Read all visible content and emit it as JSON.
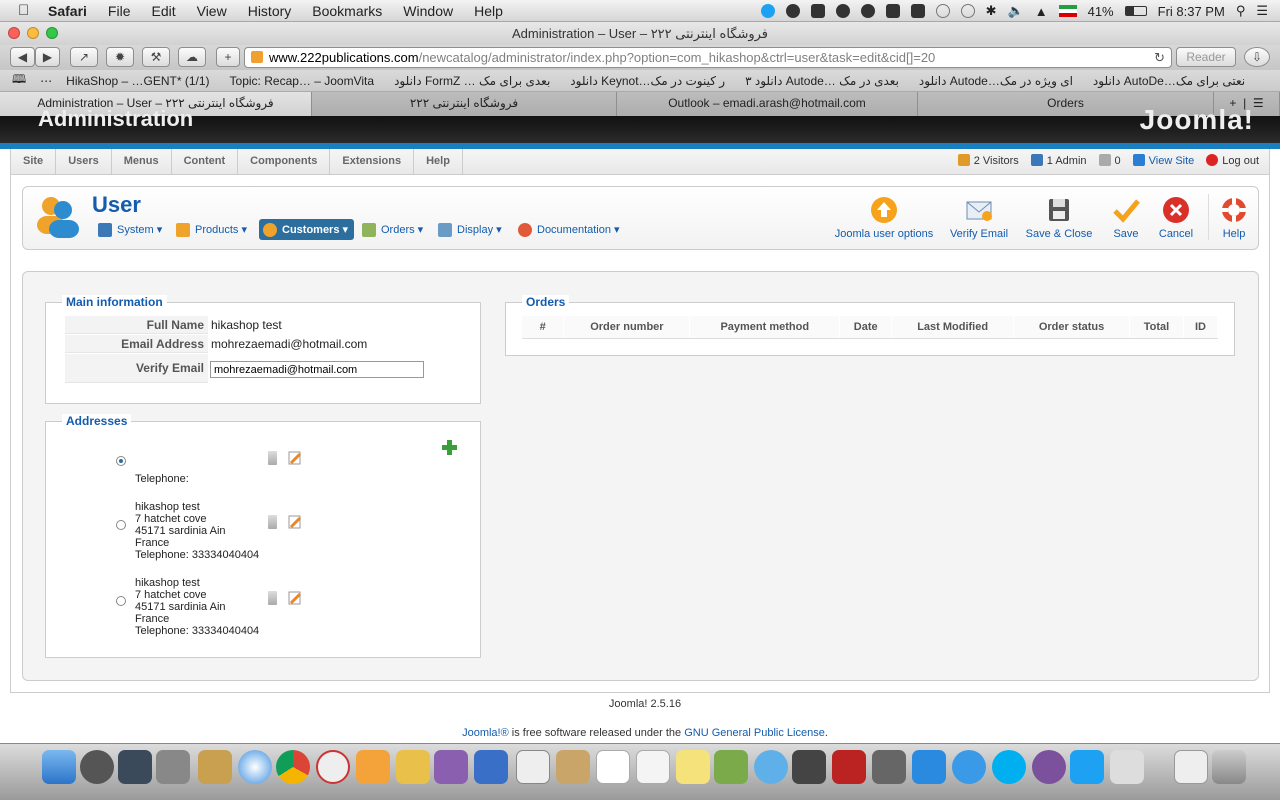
{
  "menubar": {
    "app": "Safari",
    "items": [
      "File",
      "Edit",
      "View",
      "History",
      "Bookmarks",
      "Window",
      "Help"
    ],
    "battery": "41%",
    "clock": "Fri 8:37 PM"
  },
  "window": {
    "title": "Administration – User – فروشگاه اینترنتی ۲۲۲"
  },
  "toolbar": {
    "url_host": "www.222publications.com",
    "url_path": "/newcatalog/administrator/index.php?option=com_hikashop&ctrl=user&task=edit&cid[]=20",
    "reader_label": "Reader"
  },
  "bookmarks": [
    "HikaShop – …GENT* (1/1)",
    "Topic: Recap… – JoomVita",
    "دانلود FormZ … بعدی برای مک",
    "دانلود Keynot…ر کینوت در مک",
    "دانلود ۳ Autode… بعدی در مک",
    "دانلود Autode…ای ویژه در مک",
    "دانلود AutoDe…نعتی برای مک"
  ],
  "tabs": [
    "Administration – User – فروشگاه اینترنتی ۲۲۲",
    "فروشگاه اینترنتی ۲۲۲",
    "Outlook – emadi.arash@hotmail.com",
    "Orders"
  ],
  "joomla": {
    "header": "Administration",
    "logo": "Joomla!",
    "menu": [
      "Site",
      "Users",
      "Menus",
      "Content",
      "Components",
      "Extensions",
      "Help"
    ],
    "status": {
      "visitors": "2 Visitors",
      "admins": "1 Admin",
      "messages": "0",
      "view_site": "View Site",
      "logout": "Log out"
    }
  },
  "page": {
    "title": "User",
    "submenu": [
      "System",
      "Products",
      "Customers",
      "Orders",
      "Display",
      "Documentation"
    ],
    "actions": [
      "Joomla user options",
      "Verify Email",
      "Save & Close",
      "Save",
      "Cancel",
      "Help"
    ]
  },
  "main_info": {
    "legend": "Main information",
    "full_name_label": "Full Name",
    "full_name": "hikashop test",
    "email_label": "Email Address",
    "email": "mohrezaemadi@hotmail.com",
    "verify_label": "Verify Email",
    "verify_value": "mohrezaemadi@hotmail.com"
  },
  "addresses": {
    "legend": "Addresses",
    "items": [
      {
        "lines": [
          "Telephone:"
        ]
      },
      {
        "lines": [
          "hikashop test",
          "7 hatchet cove",
          "45171 sardinia Ain",
          "France",
          "Telephone: 33334040404"
        ]
      },
      {
        "lines": [
          "hikashop test",
          "7 hatchet cove",
          "45171 sardinia Ain",
          "France",
          "Telephone: 33334040404"
        ]
      }
    ]
  },
  "orders": {
    "legend": "Orders",
    "columns": [
      "#",
      "Order number",
      "Payment method",
      "Date",
      "Last Modified",
      "Order status",
      "Total",
      "ID"
    ]
  },
  "footer": {
    "version": "Joomla! 2.5.16",
    "license_prefix": "Joomla!®",
    "license_mid": " is free software released under the ",
    "license_link": "GNU General Public License",
    "license_suffix": "."
  }
}
